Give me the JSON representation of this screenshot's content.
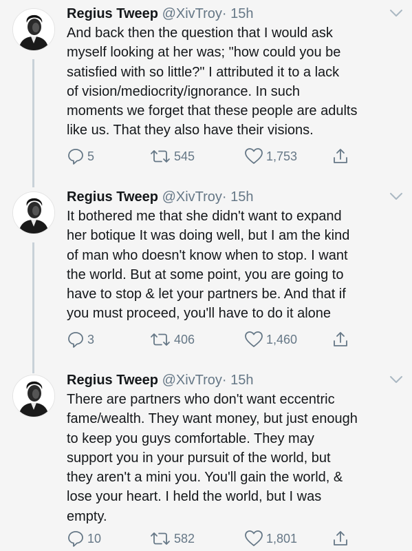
{
  "tweets": [
    {
      "author_name": "Regius Tweep",
      "handle": "@XivTroy",
      "time": "· 15h",
      "lines": [
        "And back then the question that I would ask",
        "myself looking at her was; \"how could you be",
        "satisfied with so little?\" I attributed it to a lack",
        "of vision/mediocrity/ignorance. In such",
        "moments we forget that these people are adults",
        "like us. That they also have their visions."
      ],
      "replies": "5",
      "retweets": "545",
      "likes": "1,753"
    },
    {
      "author_name": "Regius Tweep",
      "handle": "@XivTroy",
      "time": "· 15h",
      "lines": [
        "It bothered me that she didn't want to expand",
        "her botique It was doing well, but I am the kind",
        "of man who doesn't know when to stop. I want",
        "the world. But at some point, you are going to",
        "have to stop & let your partners be. And that if",
        "you must proceed, you'll have to do it alone"
      ],
      "replies": "3",
      "retweets": "406",
      "likes": "1,460"
    },
    {
      "author_name": "Regius Tweep",
      "handle": "@XivTroy",
      "time": "· 15h",
      "lines": [
        "There are partners who don't want eccentric",
        "fame/wealth. They want money, but just enough",
        "to keep you guys comfortable. They may",
        "support you in your pursuit of the world, but",
        "they aren't a mini you. You'll gain the world, &",
        "lose your heart. I held the world, but I was",
        "empty."
      ],
      "replies": "10",
      "retweets": "582",
      "likes": "1,801"
    }
  ],
  "icons": {
    "reply": "reply-icon",
    "retweet": "retweet-icon",
    "like": "heart-icon",
    "share": "share-icon",
    "caret": "chevron-down-icon"
  },
  "colors": {
    "text": "#14171a",
    "secondary": "#657786",
    "thread_line": "#c8d1d8",
    "background": "#f5f5f5"
  }
}
